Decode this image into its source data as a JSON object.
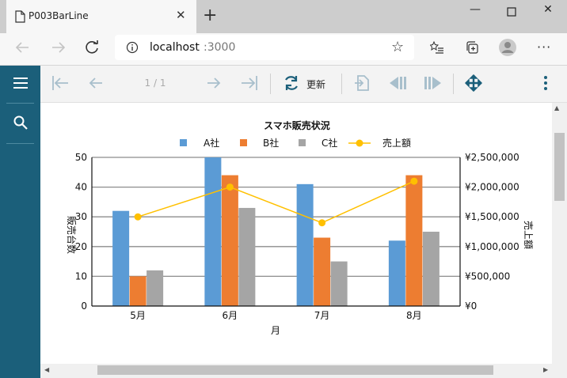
{
  "browser": {
    "tab_title": "P003BarLine",
    "url_host": "localhost",
    "url_port": ":3000"
  },
  "toolbar": {
    "page_indicator": "1 / 1",
    "refresh_label": "更新"
  },
  "colors": {
    "sidebar": "#1b5f7a",
    "series_a": "#5b9bd5",
    "series_b": "#ed7d31",
    "series_c": "#a5a5a5",
    "line": "#ffc000"
  },
  "chart_data": {
    "type": "bar",
    "title": "スマホ販売状況",
    "categories": [
      "5月",
      "6月",
      "7月",
      "8月"
    ],
    "series": [
      {
        "name": "A社",
        "values": [
          32,
          50,
          41,
          22
        ]
      },
      {
        "name": "B社",
        "values": [
          10,
          44,
          23,
          44
        ]
      },
      {
        "name": "C社",
        "values": [
          12,
          33,
          15,
          25
        ]
      }
    ],
    "line_series": {
      "name": "売上額",
      "values": [
        1500000,
        2000000,
        1400000,
        2100000
      ]
    },
    "xlabel": "月",
    "ylabel": "販売台数",
    "y2label": "売上額",
    "ylim": [
      0,
      50
    ],
    "y2lim": [
      0,
      2500000
    ],
    "yticks": [
      "0",
      "10",
      "20",
      "30",
      "40",
      "50"
    ],
    "y2ticks": [
      "¥0",
      "¥500,000",
      "¥1,000,000",
      "¥1,500,000",
      "¥2,000,000",
      "¥2,500,000"
    ],
    "grid": true,
    "legend_position": "top"
  }
}
